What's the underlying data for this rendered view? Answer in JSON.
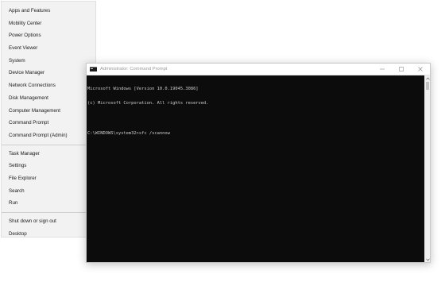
{
  "winx_menu": {
    "groups": [
      [
        "Apps and Features",
        "Mobility Center",
        "Power Options",
        "Event Viewer",
        "System",
        "Device Manager",
        "Network Connections",
        "Disk Management",
        "Computer Management",
        "Command Prompt",
        "Command Prompt (Admin)"
      ],
      [
        "Task Manager",
        "Settings",
        "File Explorer",
        "Search",
        "Run"
      ],
      [
        "Shut down or sign out",
        "Desktop"
      ]
    ]
  },
  "cmd_window": {
    "title": "Administrator: Command Prompt",
    "controls": {
      "minimize": "—",
      "maximize": "☐",
      "close": "✕"
    },
    "console_lines": [
      "Microsoft Windows [Version 10.0.19045.3086]",
      "(c) Microsoft Corporation. All rights reserved.",
      "",
      "C:\\WINDOWS\\system32>sfc /scannow"
    ],
    "colors": {
      "background": "#0c0c0c",
      "text": "#cccccc"
    }
  },
  "icons": {
    "app_icon": "cmd-app-icon",
    "scroll_up": "chevron-up-icon",
    "scroll_down": "chevron-down-icon"
  }
}
